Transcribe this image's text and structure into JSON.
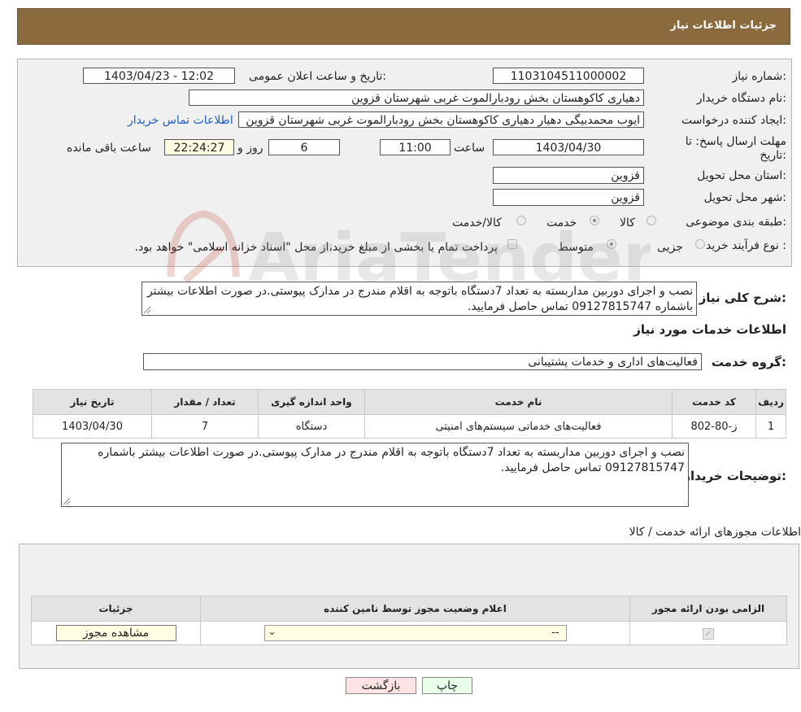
{
  "page_title": "جزئیات اطلاعات نیاز",
  "need_number": {
    "label": "شماره نیاز:",
    "value": "1103104511000002"
  },
  "announce_date": {
    "label": "تاریخ و ساعت اعلان عمومی:",
    "value": "1403/04/23 - 12:02"
  },
  "buyer_org": {
    "label": "نام دستگاه خریدار:",
    "value": "دهیاری کاکوهستان بخش رودبارالموت غربی شهرستان قزوین"
  },
  "requester": {
    "label": "ایجاد کننده درخواست:",
    "value": "ایوب محمدبیگی دهیار دهیاری کاکوهستان بخش رودبارالموت غربی شهرستان قزوین",
    "contact_link": "اطلاعات تماس خریدار"
  },
  "deadline": {
    "label_line1": "مهلت ارسال پاسخ: تا",
    "label_line2": "تاریخ:",
    "date": "1403/04/30",
    "time_label": "ساعت",
    "time": "11:00",
    "days": "6",
    "days_label": "روز و",
    "remaining": "22:24:27",
    "remaining_label": "ساعت باقی مانده"
  },
  "province": {
    "label": "استان محل تحویل:",
    "value": "قزوین"
  },
  "city": {
    "label": "شهر محل تحویل:",
    "value": "قزوین"
  },
  "category": {
    "label": "طبقه بندی موضوعی:",
    "options": [
      "کالا",
      "خدمت",
      "کالا/خدمت"
    ],
    "selected": "خدمت"
  },
  "process": {
    "label": "نوع فرآیند خرید :",
    "options": [
      "جزیی",
      "متوسط"
    ],
    "selected": "متوسط",
    "payment_note": "پرداخت تمام یا بخشی از مبلغ خرید،از محل \"اسناد خزانه اسلامی\" خواهد بود."
  },
  "summary": {
    "label": "شرح کلی نیاز:",
    "value": "نصب و اجرای دوربین مداربسته به تعداد 7دستگاه باتوجه به اقلام مندرج در مدارک پیوستی.در صورت اطلاعات بیشتر باشماره 09127815747 تماس حاصل فرمایید."
  },
  "services_title": "اطلاعات خدمات مورد نیاز",
  "service_group": {
    "label": "گروه خدمت:",
    "value": "فعالیت‌های اداری و خدمات پشتیبانی"
  },
  "service_table": {
    "headers": [
      "ردیف",
      "کد خدمت",
      "نام خدمت",
      "واحد اندازه گیری",
      "تعداد / مقدار",
      "تاریخ نیاز"
    ],
    "rows": [
      [
        "1",
        "ز-80-802",
        "فعالیت‌های خدماتی سیستم‌های امنیتی",
        "دستگاه",
        "7",
        "1403/04/30"
      ]
    ]
  },
  "buyer_notes": {
    "label": "توضیحات خریدار:",
    "value": "نصب و اجرای دوربین مداربسته به تعداد 7دستگاه باتوجه به اقلام مندرج در مدارک پیوستی.در صورت اطلاعات بیشتر باشماره 09127815747 تماس حاصل فرمایید."
  },
  "permits_title": "اطلاعات مجوزهای ارائه خدمت / کالا",
  "permits_table": {
    "headers": [
      "الزامی بودن ارائه مجوز",
      "اعلام وضعیت مجوز توسط نامین کننده",
      "جزئیات"
    ],
    "select_value": "--",
    "view_button": "مشاهده مجوز"
  },
  "buttons": {
    "print": "چاپ",
    "back": "بازگشت"
  },
  "watermark": "AriaTender.neT",
  "colors": {
    "header_bg": "#8b6a3d",
    "link": "#1a5fc8",
    "input_highlight": "#fffde2",
    "back_button": "#fde3e3",
    "print_button": "#eaffea"
  }
}
